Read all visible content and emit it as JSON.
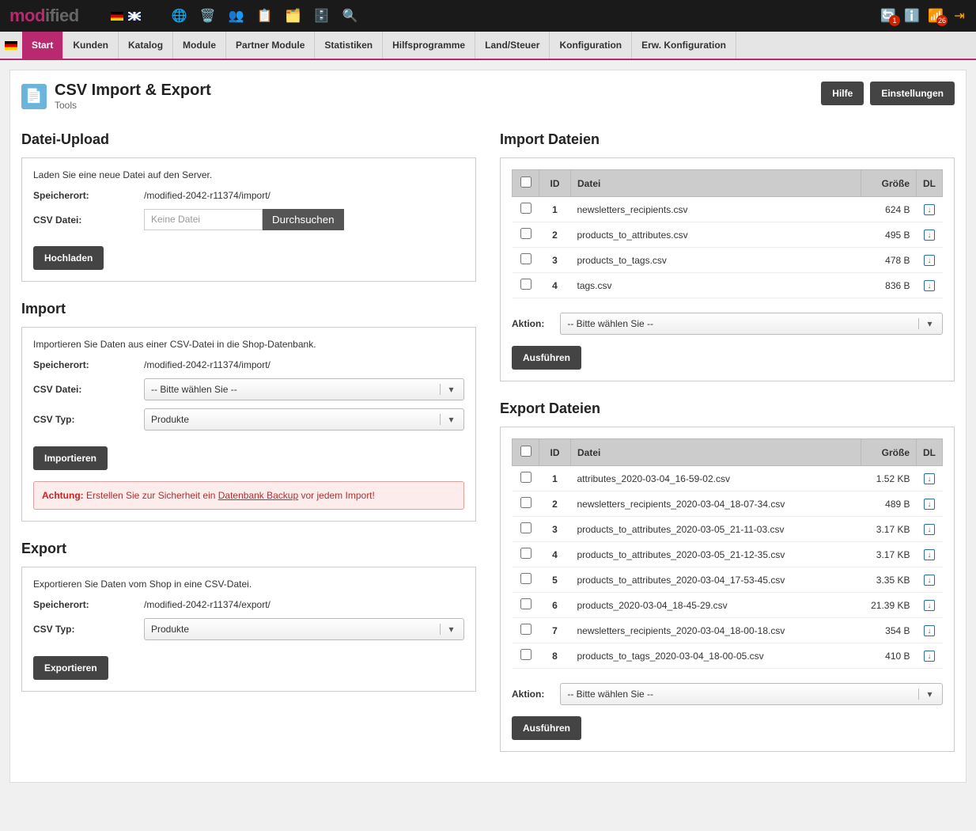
{
  "logo_part1": "mod",
  "logo_part2": "ified",
  "topbar_badge_left": "1",
  "topbar_badge_right": "26",
  "nav": [
    "Start",
    "Kunden",
    "Katalog",
    "Module",
    "Partner Module",
    "Statistiken",
    "Hilfsprogramme",
    "Land/Steuer",
    "Konfiguration",
    "Erw. Konfiguration"
  ],
  "header": {
    "title": "CSV Import & Export",
    "sub": "Tools",
    "help": "Hilfe",
    "settings": "Einstellungen"
  },
  "upload": {
    "heading": "Datei-Upload",
    "desc": "Laden Sie eine neue Datei auf den Server.",
    "loc_label": "Speicherort:",
    "loc_value": "/modified-2042-r11374/import/",
    "file_label": "CSV Datei:",
    "file_placeholder": "Keine Datei",
    "browse": "Durchsuchen",
    "submit": "Hochladen"
  },
  "import": {
    "heading": "Import",
    "desc": "Importieren Sie Daten aus einer CSV-Datei in die Shop-Datenbank.",
    "loc_label": "Speicherort:",
    "loc_value": "/modified-2042-r11374/import/",
    "file_label": "CSV Datei:",
    "file_select": "-- Bitte wählen Sie --",
    "type_label": "CSV Typ:",
    "type_select": "Produkte",
    "submit": "Importieren",
    "warn_prefix": "Achtung:",
    "warn_text_1": " Erstellen Sie zur Sicherheit ein ",
    "warn_link": "Datenbank Backup",
    "warn_text_2": " vor jedem Import!"
  },
  "export": {
    "heading": "Export",
    "desc": "Exportieren Sie Daten vom Shop in eine CSV-Datei.",
    "loc_label": "Speicherort:",
    "loc_value": "/modified-2042-r11374/export/",
    "type_label": "CSV Typ:",
    "type_select": "Produkte",
    "submit": "Exportieren"
  },
  "import_files": {
    "heading": "Import Dateien",
    "cols": {
      "id": "ID",
      "file": "Datei",
      "size": "Größe",
      "dl": "DL"
    },
    "rows": [
      {
        "id": "1",
        "file": "newsletters_recipients.csv",
        "size": "624 B"
      },
      {
        "id": "2",
        "file": "products_to_attributes.csv",
        "size": "495 B"
      },
      {
        "id": "3",
        "file": "products_to_tags.csv",
        "size": "478 B"
      },
      {
        "id": "4",
        "file": "tags.csv",
        "size": "836 B"
      }
    ],
    "action_label": "Aktion:",
    "action_select": "-- Bitte wählen Sie --",
    "run": "Ausführen"
  },
  "export_files": {
    "heading": "Export Dateien",
    "cols": {
      "id": "ID",
      "file": "Datei",
      "size": "Größe",
      "dl": "DL"
    },
    "rows": [
      {
        "id": "1",
        "file": "attributes_2020-03-04_16-59-02.csv",
        "size": "1.52 KB"
      },
      {
        "id": "2",
        "file": "newsletters_recipients_2020-03-04_18-07-34.csv",
        "size": "489 B"
      },
      {
        "id": "3",
        "file": "products_to_attributes_2020-03-05_21-11-03.csv",
        "size": "3.17 KB"
      },
      {
        "id": "4",
        "file": "products_to_attributes_2020-03-05_21-12-35.csv",
        "size": "3.17 KB"
      },
      {
        "id": "5",
        "file": "products_to_attributes_2020-03-04_17-53-45.csv",
        "size": "3.35 KB"
      },
      {
        "id": "6",
        "file": "products_2020-03-04_18-45-29.csv",
        "size": "21.39 KB"
      },
      {
        "id": "7",
        "file": "newsletters_recipients_2020-03-04_18-00-18.csv",
        "size": "354 B"
      },
      {
        "id": "8",
        "file": "products_to_tags_2020-03-04_18-00-05.csv",
        "size": "410 B"
      }
    ],
    "action_label": "Aktion:",
    "action_select": "-- Bitte wählen Sie --",
    "run": "Ausführen"
  }
}
